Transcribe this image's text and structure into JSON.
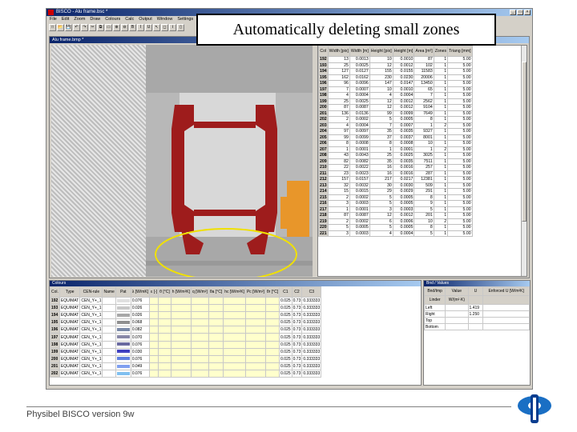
{
  "app": {
    "title": "BISCO - Alu frame.bsc *",
    "menu": [
      "File",
      "Edit",
      "Zoom",
      "Draw",
      "Colours",
      "Calc",
      "Output",
      "Window",
      "Settings"
    ],
    "toolbar": [
      "□",
      "📂",
      "💾",
      "↶",
      "↷",
      "✂",
      "⧉",
      "▭",
      "⊕",
      "⊖",
      "B",
      "I",
      "U",
      "↖",
      "◻",
      "Ⅰ",
      "▯"
    ],
    "window_buttons": [
      "_",
      "□",
      "×"
    ]
  },
  "drawing_window": {
    "caption": "Alu frame.bmp *"
  },
  "annotation": {
    "text": "Automatically deleting small zones"
  },
  "zones_grid": {
    "headers": [
      "Col",
      "Width [pix]",
      "Width [m]",
      "Height [pix]",
      "Height [m]",
      "Area [m²]",
      "Zones",
      "Triang [mm]"
    ],
    "rows": [
      [
        "192",
        "13",
        "0.0013",
        "10",
        "0.0010",
        "87",
        "1",
        "5.00"
      ],
      [
        "193",
        "25",
        "0.0025",
        "12",
        "0.0012",
        "102",
        "1",
        "5.00"
      ],
      [
        "194",
        "127",
        "0.0127",
        "155",
        "0.0155",
        "11583",
        "1",
        "5.00"
      ],
      [
        "195",
        "162",
        "0.0162",
        "230",
        "0.0230",
        "20006",
        "1",
        "5.00"
      ],
      [
        "196",
        "96",
        "0.0096",
        "147",
        "0.0147",
        "13450",
        "1",
        "5.00"
      ],
      [
        "197",
        "7",
        "0.0007",
        "10",
        "0.0010",
        "65",
        "1",
        "5.00"
      ],
      [
        "198",
        "4",
        "0.0004",
        "4",
        "0.0004",
        "7",
        "1",
        "5.00"
      ],
      [
        "199",
        "25",
        "0.0025",
        "12",
        "0.0012",
        "2562",
        "1",
        "5.00"
      ],
      [
        "200",
        "87",
        "0.0087",
        "12",
        "0.0012",
        "9104",
        "1",
        "5.00"
      ],
      [
        "201",
        "136",
        "0.0136",
        "99",
        "0.0099",
        "7649",
        "1",
        "5.00"
      ],
      [
        "202",
        "2",
        "0.0002",
        "5",
        "0.0005",
        "8",
        "1",
        "5.00"
      ],
      [
        "203",
        "4",
        "0.0004",
        "7",
        "0.0007",
        "1",
        "2",
        "5.00"
      ],
      [
        "204",
        "97",
        "0.0097",
        "35",
        "0.0035",
        "9327",
        "1",
        "5.00"
      ],
      [
        "205",
        "99",
        "0.0099",
        "37",
        "0.0037",
        "8001",
        "1",
        "5.00"
      ],
      [
        "206",
        "8",
        "0.0008",
        "8",
        "0.0008",
        "10",
        "1",
        "5.00"
      ],
      [
        "207",
        "1",
        "0.0001",
        "1",
        "0.0001",
        "1",
        "2",
        "5.00"
      ],
      [
        "208",
        "43",
        "0.0043",
        "25",
        "0.0025",
        "3025",
        "1",
        "5.00"
      ],
      [
        "209",
        "82",
        "0.0082",
        "35",
        "0.0035",
        "7511",
        "1",
        "5.00"
      ],
      [
        "210",
        "22",
        "0.0022",
        "16",
        "0.0016",
        "257",
        "1",
        "5.00"
      ],
      [
        "211",
        "23",
        "0.0023",
        "16",
        "0.0016",
        "287",
        "1",
        "5.00"
      ],
      [
        "212",
        "157",
        "0.0157",
        "217",
        "0.0217",
        "12381",
        "1",
        "5.00"
      ],
      [
        "213",
        "32",
        "0.0032",
        "30",
        "0.0030",
        "509",
        "1",
        "5.00"
      ],
      [
        "214",
        "15",
        "0.0015",
        "29",
        "0.0029",
        "291",
        "1",
        "5.00"
      ],
      [
        "215",
        "2",
        "0.0002",
        "5",
        "0.0005",
        "8",
        "1",
        "5.00"
      ],
      [
        "216",
        "3",
        "0.0003",
        "5",
        "0.0005",
        "9",
        "1",
        "5.00"
      ],
      [
        "217",
        "1",
        "0.0001",
        "3",
        "0.0003",
        "5",
        "1",
        "5.00"
      ],
      [
        "218",
        "87",
        "0.0087",
        "12",
        "0.0012",
        "201",
        "1",
        "5.00"
      ],
      [
        "219",
        "2",
        "0.0002",
        "6",
        "0.0006",
        "10",
        "2",
        "5.00"
      ],
      [
        "220",
        "5",
        "0.0005",
        "5",
        "0.0005",
        "8",
        "1",
        "5.00"
      ],
      [
        "221",
        "3",
        "0.0003",
        "4",
        "0.0004",
        "5",
        "1",
        "5.00"
      ]
    ]
  },
  "colours_window": {
    "caption": "Colours",
    "headers": [
      "Col.",
      "Type",
      "CEN-rule",
      "Name",
      "Pat",
      "λ [W/mK]",
      "ε [-]",
      "θ [°C]",
      "h [W/m²K]",
      "q [W/m²]",
      "θa [°C]",
      "hc [W/m²K]",
      "Pc [W/m²]",
      "θr [°C]",
      "C1",
      "C2",
      "C3"
    ],
    "rows": [
      {
        "col": "192",
        "type": "EQUIMAT",
        "cen": "CEN_Y+_1",
        "name": "",
        "pat": "#e0e0e0",
        "lambda": "0.076",
        "c1": "0.025",
        "c2": "0.73",
        "c3": "0.333333"
      },
      {
        "col": "193",
        "type": "EQUIMAT",
        "cen": "CEN_Y+_1",
        "name": "",
        "pat": "#c8c8c8",
        "lambda": "0.026",
        "c1": "0.025",
        "c2": "0.73",
        "c3": "0.333333"
      },
      {
        "col": "194",
        "type": "EQUIMAT",
        "cen": "CEN_Y+_1",
        "name": "",
        "pat": "#a8a8a8",
        "lambda": "0.026",
        "c1": "0.025",
        "c2": "0.73",
        "c3": "0.333333"
      },
      {
        "col": "195",
        "type": "EQUIMAT",
        "cen": "CEN_Y+_1",
        "name": "",
        "pat": "#909090",
        "lambda": "0.068",
        "c1": "0.025",
        "c2": "0.73",
        "c3": "0.333333"
      },
      {
        "col": "196",
        "type": "EQUIMAT",
        "cen": "CEN_Y+_1",
        "name": "",
        "pat": "#7a8aa8",
        "lambda": "0.082",
        "c1": "0.025",
        "c2": "0.73",
        "c3": "0.333333"
      },
      {
        "col": "197",
        "type": "EQUIMAT",
        "cen": "CEN_Y+_1",
        "name": "",
        "pat": "#8888a8",
        "lambda": "0.070",
        "c1": "0.025",
        "c2": "0.73",
        "c3": "0.333333"
      },
      {
        "col": "198",
        "type": "EQUIMAT",
        "cen": "CEN_Y+_1",
        "name": "",
        "pat": "#6a6aa0",
        "lambda": "0.076",
        "c1": "0.025",
        "c2": "0.73",
        "c3": "0.333333"
      },
      {
        "col": "199",
        "type": "EQUIMAT",
        "cen": "CEN_Y+_1",
        "name": "",
        "pat": "#4040c0",
        "lambda": "0.030",
        "c1": "0.025",
        "c2": "0.73",
        "c3": "0.333333"
      },
      {
        "col": "200",
        "type": "EQUIMAT",
        "cen": "CEN_Y+_1",
        "name": "",
        "pat": "#6080e0",
        "lambda": "0.076",
        "c1": "0.025",
        "c2": "0.73",
        "c3": "0.333333"
      },
      {
        "col": "201",
        "type": "EQUIMAT",
        "cen": "CEN_Y+_1",
        "name": "",
        "pat": "#80a0f0",
        "lambda": "0.049",
        "c1": "0.025",
        "c2": "0.73",
        "c3": "0.333333"
      },
      {
        "col": "202",
        "type": "EQUIMAT",
        "cen": "CEN_Y+_1",
        "name": "",
        "pat": "#80c0f0",
        "lambda": "0.076",
        "c1": "0.025",
        "c2": "0.73",
        "c3": "0.333333"
      }
    ]
  },
  "boundary_window": {
    "caption": "Bnd / Values",
    "headers": [
      "Bnd/tmp",
      "Value",
      "U",
      "Enforced U [W/m²K]"
    ],
    "sub_headers": [
      "Linder",
      "W/(m²·K)"
    ],
    "rows": [
      [
        "Left",
        "",
        "1.419",
        ""
      ],
      [
        "Right",
        "",
        "1.250",
        ""
      ],
      [
        "Top",
        "",
        "",
        ""
      ],
      [
        "Bottom",
        "",
        "",
        ""
      ]
    ]
  },
  "footer": {
    "text": "Physibel BISCO version 9w"
  },
  "colors": {
    "frame_red": "#9e1c1c",
    "insulation_orange": "#e8962a",
    "frame_grey": "#a8a8a8",
    "highlight_ellipse": "#f0e000"
  }
}
